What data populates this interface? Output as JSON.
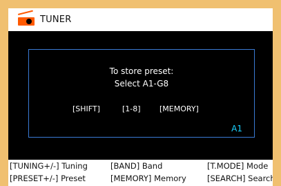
{
  "header": {
    "title": "TUNER",
    "icon": "tuner-radio-icon",
    "icon_color": "#ff5a00"
  },
  "dialog": {
    "line1": "To store preset:",
    "line2": "Select  A1-G8",
    "keys": [
      "[SHIFT]",
      "[1-8]",
      "[MEMORY]"
    ],
    "status": "A1",
    "border_color": "#3a7bd5",
    "status_color": "#1ad1ff"
  },
  "footer": {
    "row1": [
      "[TUNING+/-] Tuning",
      "[BAND] Band",
      "[T.MODE] Mode"
    ],
    "row2": [
      "[PRESET+/-] Preset",
      "[MEMORY] Memory",
      "[SEARCH] Search"
    ]
  }
}
